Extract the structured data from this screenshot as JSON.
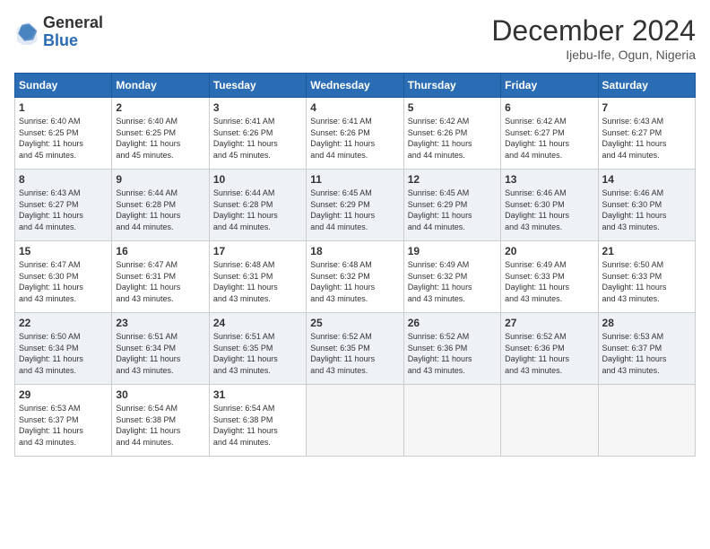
{
  "header": {
    "logo_general": "General",
    "logo_blue": "Blue",
    "month_title": "December 2024",
    "location": "Ijebu-Ife, Ogun, Nigeria"
  },
  "days_of_week": [
    "Sunday",
    "Monday",
    "Tuesday",
    "Wednesday",
    "Thursday",
    "Friday",
    "Saturday"
  ],
  "weeks": [
    [
      {
        "day": "1",
        "sunrise": "6:40 AM",
        "sunset": "6:25 PM",
        "daylight": "11 hours and 45 minutes."
      },
      {
        "day": "2",
        "sunrise": "6:40 AM",
        "sunset": "6:25 PM",
        "daylight": "11 hours and 45 minutes."
      },
      {
        "day": "3",
        "sunrise": "6:41 AM",
        "sunset": "6:26 PM",
        "daylight": "11 hours and 45 minutes."
      },
      {
        "day": "4",
        "sunrise": "6:41 AM",
        "sunset": "6:26 PM",
        "daylight": "11 hours and 44 minutes."
      },
      {
        "day": "5",
        "sunrise": "6:42 AM",
        "sunset": "6:26 PM",
        "daylight": "11 hours and 44 minutes."
      },
      {
        "day": "6",
        "sunrise": "6:42 AM",
        "sunset": "6:27 PM",
        "daylight": "11 hours and 44 minutes."
      },
      {
        "day": "7",
        "sunrise": "6:43 AM",
        "sunset": "6:27 PM",
        "daylight": "11 hours and 44 minutes."
      }
    ],
    [
      {
        "day": "8",
        "sunrise": "6:43 AM",
        "sunset": "6:27 PM",
        "daylight": "11 hours and 44 minutes."
      },
      {
        "day": "9",
        "sunrise": "6:44 AM",
        "sunset": "6:28 PM",
        "daylight": "11 hours and 44 minutes."
      },
      {
        "day": "10",
        "sunrise": "6:44 AM",
        "sunset": "6:28 PM",
        "daylight": "11 hours and 44 minutes."
      },
      {
        "day": "11",
        "sunrise": "6:45 AM",
        "sunset": "6:29 PM",
        "daylight": "11 hours and 44 minutes."
      },
      {
        "day": "12",
        "sunrise": "6:45 AM",
        "sunset": "6:29 PM",
        "daylight": "11 hours and 44 minutes."
      },
      {
        "day": "13",
        "sunrise": "6:46 AM",
        "sunset": "6:30 PM",
        "daylight": "11 hours and 43 minutes."
      },
      {
        "day": "14",
        "sunrise": "6:46 AM",
        "sunset": "6:30 PM",
        "daylight": "11 hours and 43 minutes."
      }
    ],
    [
      {
        "day": "15",
        "sunrise": "6:47 AM",
        "sunset": "6:30 PM",
        "daylight": "11 hours and 43 minutes."
      },
      {
        "day": "16",
        "sunrise": "6:47 AM",
        "sunset": "6:31 PM",
        "daylight": "11 hours and 43 minutes."
      },
      {
        "day": "17",
        "sunrise": "6:48 AM",
        "sunset": "6:31 PM",
        "daylight": "11 hours and 43 minutes."
      },
      {
        "day": "18",
        "sunrise": "6:48 AM",
        "sunset": "6:32 PM",
        "daylight": "11 hours and 43 minutes."
      },
      {
        "day": "19",
        "sunrise": "6:49 AM",
        "sunset": "6:32 PM",
        "daylight": "11 hours and 43 minutes."
      },
      {
        "day": "20",
        "sunrise": "6:49 AM",
        "sunset": "6:33 PM",
        "daylight": "11 hours and 43 minutes."
      },
      {
        "day": "21",
        "sunrise": "6:50 AM",
        "sunset": "6:33 PM",
        "daylight": "11 hours and 43 minutes."
      }
    ],
    [
      {
        "day": "22",
        "sunrise": "6:50 AM",
        "sunset": "6:34 PM",
        "daylight": "11 hours and 43 minutes."
      },
      {
        "day": "23",
        "sunrise": "6:51 AM",
        "sunset": "6:34 PM",
        "daylight": "11 hours and 43 minutes."
      },
      {
        "day": "24",
        "sunrise": "6:51 AM",
        "sunset": "6:35 PM",
        "daylight": "11 hours and 43 minutes."
      },
      {
        "day": "25",
        "sunrise": "6:52 AM",
        "sunset": "6:35 PM",
        "daylight": "11 hours and 43 minutes."
      },
      {
        "day": "26",
        "sunrise": "6:52 AM",
        "sunset": "6:36 PM",
        "daylight": "11 hours and 43 minutes."
      },
      {
        "day": "27",
        "sunrise": "6:52 AM",
        "sunset": "6:36 PM",
        "daylight": "11 hours and 43 minutes."
      },
      {
        "day": "28",
        "sunrise": "6:53 AM",
        "sunset": "6:37 PM",
        "daylight": "11 hours and 43 minutes."
      }
    ],
    [
      {
        "day": "29",
        "sunrise": "6:53 AM",
        "sunset": "6:37 PM",
        "daylight": "11 hours and 43 minutes."
      },
      {
        "day": "30",
        "sunrise": "6:54 AM",
        "sunset": "6:38 PM",
        "daylight": "11 hours and 44 minutes."
      },
      {
        "day": "31",
        "sunrise": "6:54 AM",
        "sunset": "6:38 PM",
        "daylight": "11 hours and 44 minutes."
      },
      null,
      null,
      null,
      null
    ]
  ]
}
